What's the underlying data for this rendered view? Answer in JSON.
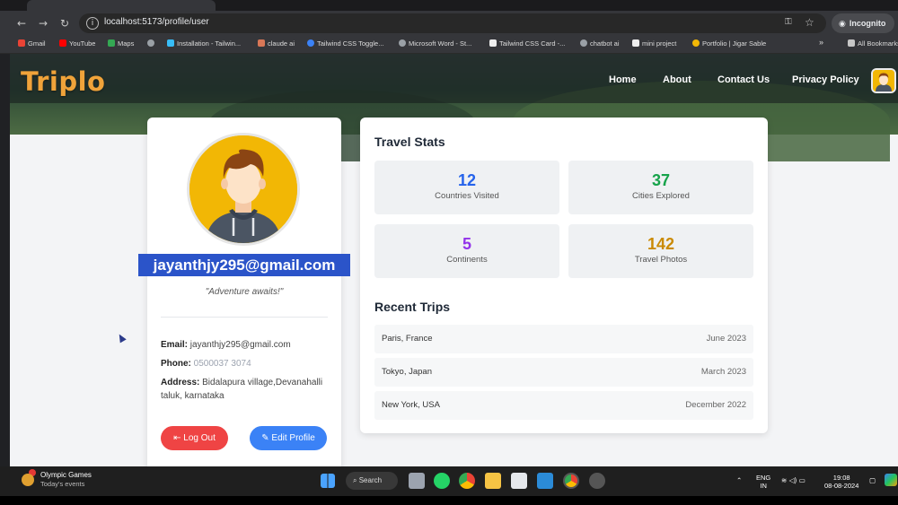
{
  "browser": {
    "url": "localhost:5173/profile/user",
    "mode_label": "Incognito",
    "bookmarks_more": "»",
    "bookmarks": [
      {
        "label": "Gmail",
        "color": "#ea4335"
      },
      {
        "label": "YouTube",
        "color": "#ff0000"
      },
      {
        "label": "Maps",
        "color": "#34a853"
      },
      {
        "label": "",
        "color": "#9aa0a6"
      },
      {
        "label": "Installation - Tailwin...",
        "color": "#38bdf8"
      },
      {
        "label": "claude ai",
        "color": "#d97757"
      },
      {
        "label": "Tailwind CSS Toggle...",
        "color": "#3b82f6"
      },
      {
        "label": "Microsoft Word - St...",
        "color": "#9aa0a6"
      },
      {
        "label": "Tailwind CSS Card -...",
        "color": "#eeeeee"
      },
      {
        "label": "chatbot ai",
        "color": "#9aa0a6"
      },
      {
        "label": "mini project",
        "color": "#eeeeee"
      },
      {
        "label": "Portfolio | Jigar Sable",
        "color": "#f2b705"
      },
      {
        "label": "All Bookmarks",
        "color": "#c7c7c7"
      }
    ]
  },
  "site": {
    "logo": "Triplo",
    "nav": [
      "Home",
      "About",
      "Contact Us",
      "Privacy Policy"
    ]
  },
  "profile": {
    "email_heading": "jayanthjy295@gmail.com",
    "motto": "\"Adventure awaits!\"",
    "email_label": "Email:",
    "email_value": "jayanthjy295@gmail.com",
    "phone_label": "Phone:",
    "phone_value": "0500037 3074",
    "address_label": "Address:",
    "address_value": "Bidalapura village,Devanahalli taluk, karnataka",
    "logout_label": "Log Out",
    "edit_label": "Edit Profile"
  },
  "stats": {
    "title": "Travel Stats",
    "items": [
      {
        "value": "12",
        "label": "Countries Visited",
        "color": "#2563eb"
      },
      {
        "value": "37",
        "label": "Cities Explored",
        "color": "#16a34a"
      },
      {
        "value": "5",
        "label": "Continents",
        "color": "#9333ea"
      },
      {
        "value": "142",
        "label": "Travel Photos",
        "color": "#ca8a04"
      }
    ]
  },
  "trips": {
    "title": "Recent Trips",
    "items": [
      {
        "place": "Paris, France",
        "date": "June 2023"
      },
      {
        "place": "Tokyo, Japan",
        "date": "March 2023"
      },
      {
        "place": "New York, USA",
        "date": "December 2022"
      }
    ]
  },
  "taskbar": {
    "news_title": "Olympic Games",
    "news_sub": "Today's events",
    "search_label": "Search",
    "lang_top": "ENG",
    "lang_bottom": "IN",
    "time": "19:08",
    "date": "08-08-2024"
  }
}
